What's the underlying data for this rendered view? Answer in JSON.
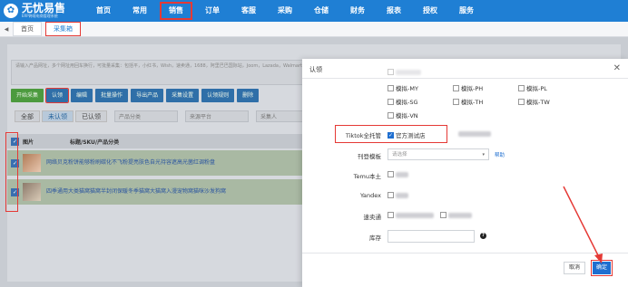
{
  "brand": {
    "name": "无忧易售",
    "subtitle": "ERP跨境电商管理系统"
  },
  "nav": [
    "首页",
    "常用",
    "销售",
    "订单",
    "客服",
    "采购",
    "仓储",
    "财务",
    "报表",
    "授权",
    "服务"
  ],
  "tabs": [
    "首页",
    "采集箱"
  ],
  "background": {
    "textarea_placeholder": "请输入产品网址，多个网址用回车换行，可批量采集：包括平，小红书，Wish，速卖通，1688，阿里巴巴国际站，Joom，Lazada，Walmart，Banggood，Temu，京东商城，拼多多，天猫，当当网，亚马逊，微店，Shopee，网易严选，ETSY，Yandex等平台。",
    "toolbar": [
      "开始采集",
      "认领",
      "编辑",
      "批量操作",
      "导出产品",
      "采集设置",
      "认领规则",
      "删除"
    ],
    "filters": [
      "全部",
      "未认领",
      "已认领"
    ],
    "category_placeholder": "产品分类",
    "source_placeholder": "来源平台",
    "claimer_placeholder": "采集人",
    "col_image": "图片",
    "col_title": "标题/SKU/产品分类",
    "rows": [
      "网络贝克粉饼能够粉刷碳化不飞粉提亮肤色自光持容遮高光菌红调粉盘",
      "四季通用大类猫窝猫窝半封闭保暖冬季猫窝大猫窝入漫宠物窝猫咪沙发狗窝"
    ]
  },
  "dialog": {
    "title": "认领",
    "mock_options": [
      "模拟-MY",
      "模拟-PH",
      "模拟-PL",
      "模拟-SG",
      "模拟-TH",
      "模拟-TW",
      "模拟-VN"
    ],
    "tiktok_label": "Tiktok全托管",
    "tiktok_store": "官方测试店",
    "template_label": "刊登模板",
    "template_placeholder": "请选择",
    "help_link": "帮助",
    "temu_label": "Temu本土",
    "yandex_label": "Yandex",
    "aliexpress_label": "速卖通",
    "stock_label": "库存",
    "cancel": "取消",
    "confirm": "确定"
  },
  "colors": {
    "brand": "#1f7fd4",
    "highlight": "#e53935",
    "primary": "#1f6fd0"
  }
}
